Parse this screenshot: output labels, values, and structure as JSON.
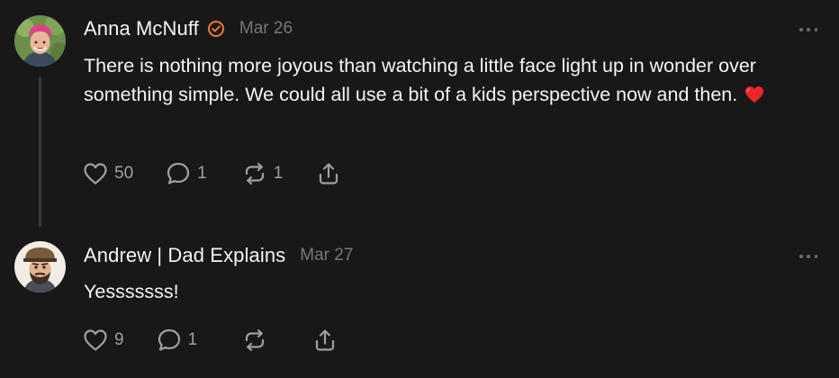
{
  "posts": [
    {
      "username": "Anna McNuff",
      "verified": true,
      "timestamp": "Mar 26",
      "text": "There is nothing more joyous than watching a little face light up in wonder over something simple. We could all use a bit of a kids perspective now and then.",
      "emoji": "red-heart",
      "actions": {
        "like_count": "50",
        "reply_count": "1",
        "repost_count": "1"
      }
    },
    {
      "username": "Andrew | Dad Explains",
      "verified": false,
      "timestamp": "Mar 27",
      "text": "Yesssssss!",
      "actions": {
        "like_count": "9",
        "reply_count": "1",
        "repost_count": ""
      }
    }
  ],
  "colors": {
    "background": "#181818",
    "text": "#f3f5f7",
    "muted": "#777777",
    "icon": "#a0a0a0",
    "verified": "#f0782d",
    "thread_line": "#3b3b3b"
  },
  "icons": [
    "heart-icon",
    "comment-icon",
    "repost-icon",
    "share-icon",
    "more-icon",
    "verified-icon"
  ]
}
